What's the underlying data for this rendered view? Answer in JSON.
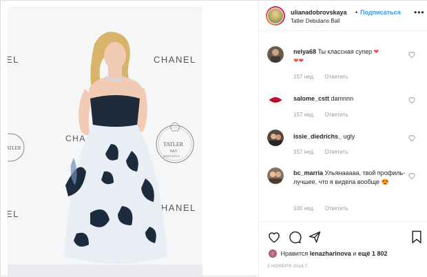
{
  "post": {
    "username": "ulianadobrovskaya",
    "dot": "•",
    "follow_label": "Подписаться",
    "location": "Tatler Debutans Ball",
    "more_label": "•••"
  },
  "photo_text": {
    "chanel_1": "CHANEL",
    "chanel_2": "CHANEL",
    "chanel_3": "CHANEL",
    "chanel_left": "EL",
    "chanel_left_2": "EL",
    "tatler_1": "TATLER",
    "tatler_2": "TATLER",
    "tatler_3": "БАЛ",
    "tatler_4": "ДЕБЮТАНТОК",
    "cha": "CHA"
  },
  "comments": [
    {
      "username": "nelya68",
      "text": "Ты классная супер",
      "emoji": "❤",
      "emoji2": "❤❤",
      "age": "157 нед.",
      "reply": "Ответить"
    },
    {
      "username": "salome_cstt",
      "text": "damnnn",
      "age": "157 нед.",
      "reply": "Ответить"
    },
    {
      "username": "issie_diedrichs_",
      "text": "ugly",
      "age": "157 нед.",
      "reply": "Ответить"
    },
    {
      "username": "bc_marria",
      "text": "Ульянааааа, твой профиль- лучшее, что я видела вообще",
      "emoji": "😍",
      "age": "100 нед.",
      "reply": "Ответить"
    }
  ],
  "likes": {
    "prefix": "Нравится",
    "user": "lenazharinova",
    "middle": "и",
    "rest": "ещё 1 802"
  },
  "date": "3 НОЯБРЯ 2016 Г.",
  "icons": [
    "heart-icon",
    "comment-icon",
    "share-icon",
    "bookmark-icon",
    "more-icon",
    "like-icon"
  ],
  "colors": {
    "link": "#3897f0",
    "heart": "#ed4956",
    "muted": "#999999",
    "text": "#262626"
  }
}
